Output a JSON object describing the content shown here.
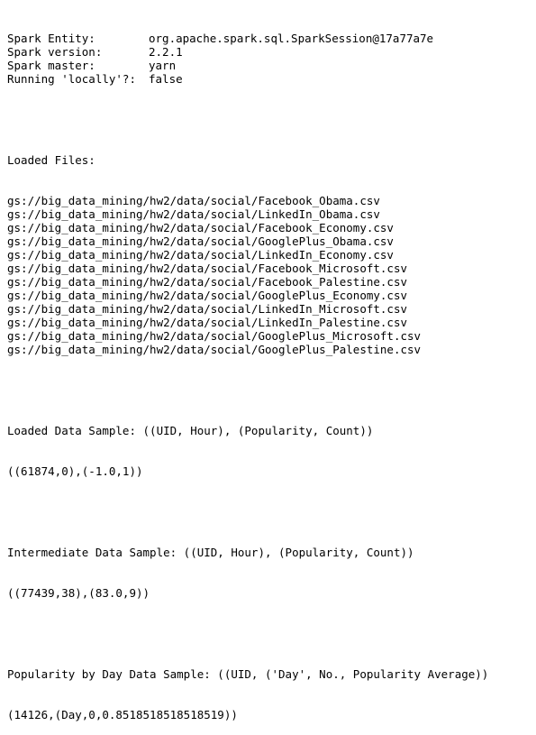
{
  "spark_info": [
    {
      "key": "Spark Entity:",
      "value": "org.apache.spark.sql.SparkSession@17a77a7e"
    },
    {
      "key": "Spark version:",
      "value": "2.2.1"
    },
    {
      "key": "Spark master:",
      "value": "yarn"
    },
    {
      "key": "Running 'locally'?:",
      "value": "false"
    }
  ],
  "loaded_files": {
    "heading": "Loaded Files:",
    "files": [
      "gs://big_data_mining/hw2/data/social/Facebook_Obama.csv",
      "gs://big_data_mining/hw2/data/social/LinkedIn_Obama.csv",
      "gs://big_data_mining/hw2/data/social/Facebook_Economy.csv",
      "gs://big_data_mining/hw2/data/social/GooglePlus_Obama.csv",
      "gs://big_data_mining/hw2/data/social/LinkedIn_Economy.csv",
      "gs://big_data_mining/hw2/data/social/Facebook_Microsoft.csv",
      "gs://big_data_mining/hw2/data/social/Facebook_Palestine.csv",
      "gs://big_data_mining/hw2/data/social/GooglePlus_Economy.csv",
      "gs://big_data_mining/hw2/data/social/LinkedIn_Microsoft.csv",
      "gs://big_data_mining/hw2/data/social/LinkedIn_Palestine.csv",
      "gs://big_data_mining/hw2/data/social/GooglePlus_Microsoft.csv",
      "gs://big_data_mining/hw2/data/social/GooglePlus_Palestine.csv"
    ]
  },
  "samples": {
    "loaded": {
      "heading": "Loaded Data Sample: ((UID, Hour), (Popularity, Count))",
      "value": "((61874,0),(-1.0,1))"
    },
    "intermediate": {
      "heading": "Intermediate Data Sample: ((UID, Hour), (Popularity, Count))",
      "value": "((77439,38),(83.0,9))"
    },
    "popularity_by_day": {
      "heading": "Popularity by Day Data Sample: ((UID, ('Day', No., Popularity Average))",
      "value": "(14126,(Day,0,0.8518518518518519))"
    }
  }
}
